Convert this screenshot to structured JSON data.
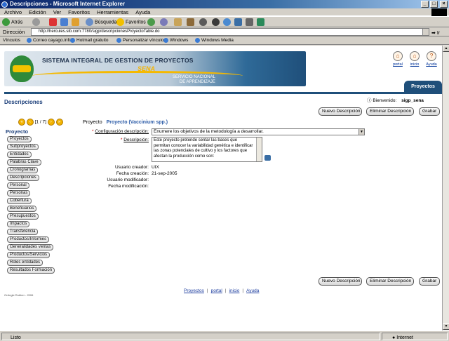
{
  "window": {
    "title": "Descripciones - Microsoft Internet Explorer",
    "controls": [
      "_",
      "□",
      "×"
    ]
  },
  "menu": [
    "Archivo",
    "Edición",
    "Ver",
    "Favoritos",
    "Herramientas",
    "Ayuda"
  ],
  "toolbar": {
    "back": "Atrás",
    "search": "Búsqueda",
    "favorites": "Favoritos"
  },
  "address": {
    "label": "Dirección",
    "url": "http://hercules.sib.com:7780/sigp/descripcionesProyectoTable.do",
    "go": "Ir"
  },
  "links": {
    "label": "Vínculos",
    "items": [
      "Correo cayago.info",
      "Hotmail gratuito",
      "Personalizar vínculos",
      "Windows",
      "Windows Media"
    ]
  },
  "banner": {
    "title": "SISTEMA INTEGRAL DE GESTION DE PROYECTOS",
    "brand": "SENA",
    "sub1": "SERVICIO NACIONAL",
    "sub2": "DE APRENDIZAJE"
  },
  "top_links": [
    "portal",
    "inicio",
    "Ayuda"
  ],
  "nav_tab": "Proyectos",
  "welcome": {
    "label": "Bienvenido:",
    "user": "sigp_sena"
  },
  "page_title": "Descripciones",
  "actions": {
    "new": "Nuevo Descripción",
    "delete": "Eliminar Descripción",
    "save": "Grabar"
  },
  "pager": {
    "text": "[1 / 7]"
  },
  "crumb": {
    "label": "Proyecto",
    "value": "Proyecto (Vaccinium spp.)"
  },
  "sidebar": {
    "head": "Proyecto",
    "items": [
      "Proyectos",
      "Subproyectos",
      "Entidades",
      "Palabras Clave",
      "Cronogramas",
      "Descripciones",
      "Personal",
      "Personas",
      "Cobertura",
      "Beneficiarios",
      "Presupuestos",
      "Impactos",
      "Transferencia",
      "Productos/Informes",
      "Generalidades ventas",
      "Productos/Servicios",
      "Roles entidades",
      "Resultados Formación"
    ]
  },
  "form": {
    "config_label": "Configuración descripción:",
    "config_value": "Enumere los objetivos de la metodología a desarrollar.",
    "desc_label": "Descripción:",
    "desc_value": "Este proyecto pretende sentar las bases que permitan conocer la variabilidad genética e identificar las zonas potenciales de cultivo y los factores que afectan la producción como son:",
    "creator_label": "Usuario creador:",
    "creator_value": "UIX",
    "created_label": "Fecha creación:",
    "created_value": "21-sep-2005",
    "modifier_label": "Usuario modificador:",
    "modifier_value": "",
    "modified_label": "Fecha modificación:",
    "modified_value": ""
  },
  "footer_links": [
    "Proyectos",
    "portal",
    "inicio",
    "Ayuda"
  ],
  "copyright": "OrAngle Rubber - 2006",
  "status": {
    "left": "Listo",
    "zone": "Internet"
  }
}
